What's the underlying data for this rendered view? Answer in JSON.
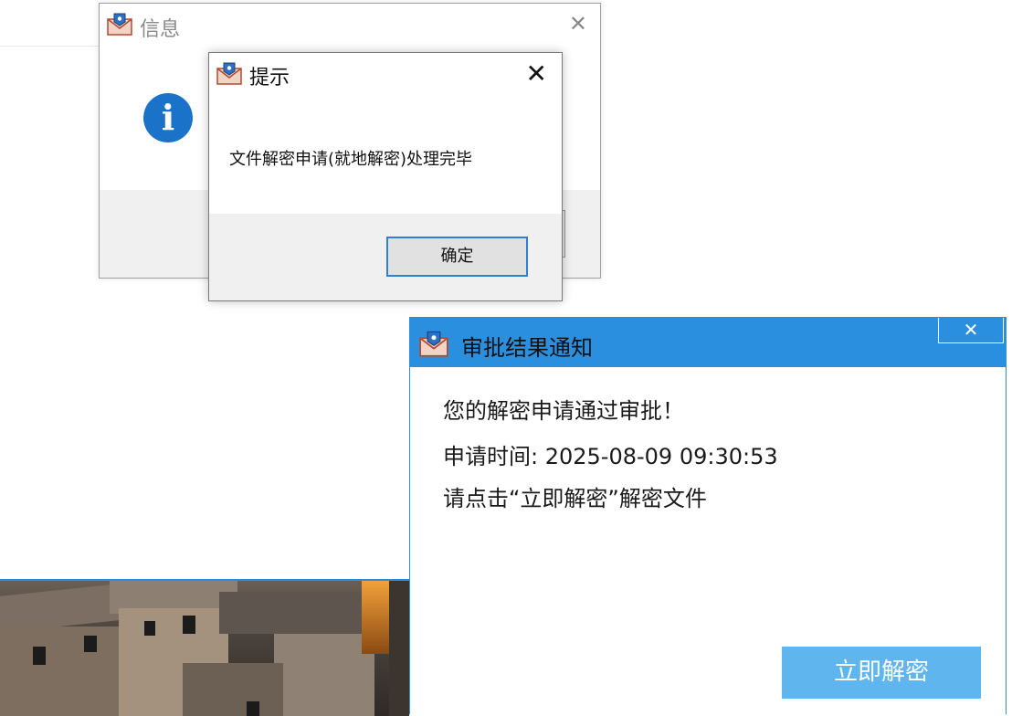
{
  "info_dialog": {
    "title": "信息",
    "close_glyph": "✕",
    "icon": "info-icon"
  },
  "prompt_dialog": {
    "title": "提示",
    "close_glyph": "✕",
    "message": "文件解密申请(就地解密)处理完毕",
    "ok_label": "确定"
  },
  "notification": {
    "title": "审批结果通知",
    "close_glyph": "✕",
    "line1": "您的解密申请通过审批！",
    "line2": "申请时间: 2025-08-09 09:30:53",
    "line3": "请点击“立即解密”解密文件",
    "action_label": "立即解密",
    "accent_color": "#2b8fe0",
    "button_color": "#5fb5ee"
  },
  "app_icon": "mail-shield-icon"
}
